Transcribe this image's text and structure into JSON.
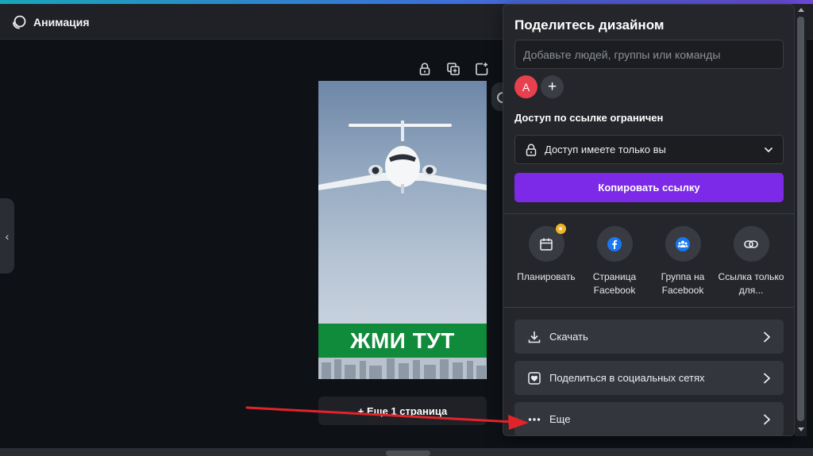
{
  "topbar": {
    "animation_label": "Анимация"
  },
  "canvas": {
    "design_text": "ЖМИ ТУТ",
    "more_pages_label": "+ Еще 1 страница"
  },
  "share_panel": {
    "title": "Поделитесь дизайном",
    "people_placeholder": "Добавьте людей, группы или команды",
    "avatar_initial": "A",
    "add_person_symbol": "+",
    "access_label": "Доступ по ссылке ограничен",
    "access_value": "Доступ имеете только вы",
    "copy_link_label": "Копировать ссылку",
    "share_options": [
      {
        "label": "Планировать",
        "icon": "calendar-icon",
        "premium": true
      },
      {
        "label": "Страница Facebook",
        "icon": "facebook-icon"
      },
      {
        "label": "Группа на Facebook",
        "icon": "facebook-group-icon"
      },
      {
        "label": "Ссылка только для...",
        "icon": "link-icon"
      }
    ],
    "actions": [
      {
        "label": "Скачать",
        "icon": "download-icon"
      },
      {
        "label": "Поделиться в социальных сетях",
        "icon": "heart-icon"
      },
      {
        "label": "Еще",
        "icon": "more-dots-icon"
      }
    ]
  },
  "colors": {
    "accent_purple": "#7d2ae8",
    "avatar_red": "#e8404e",
    "cta_green": "#108a3b",
    "annotation_red": "#e0242a",
    "facebook_blue": "#1877f2"
  }
}
